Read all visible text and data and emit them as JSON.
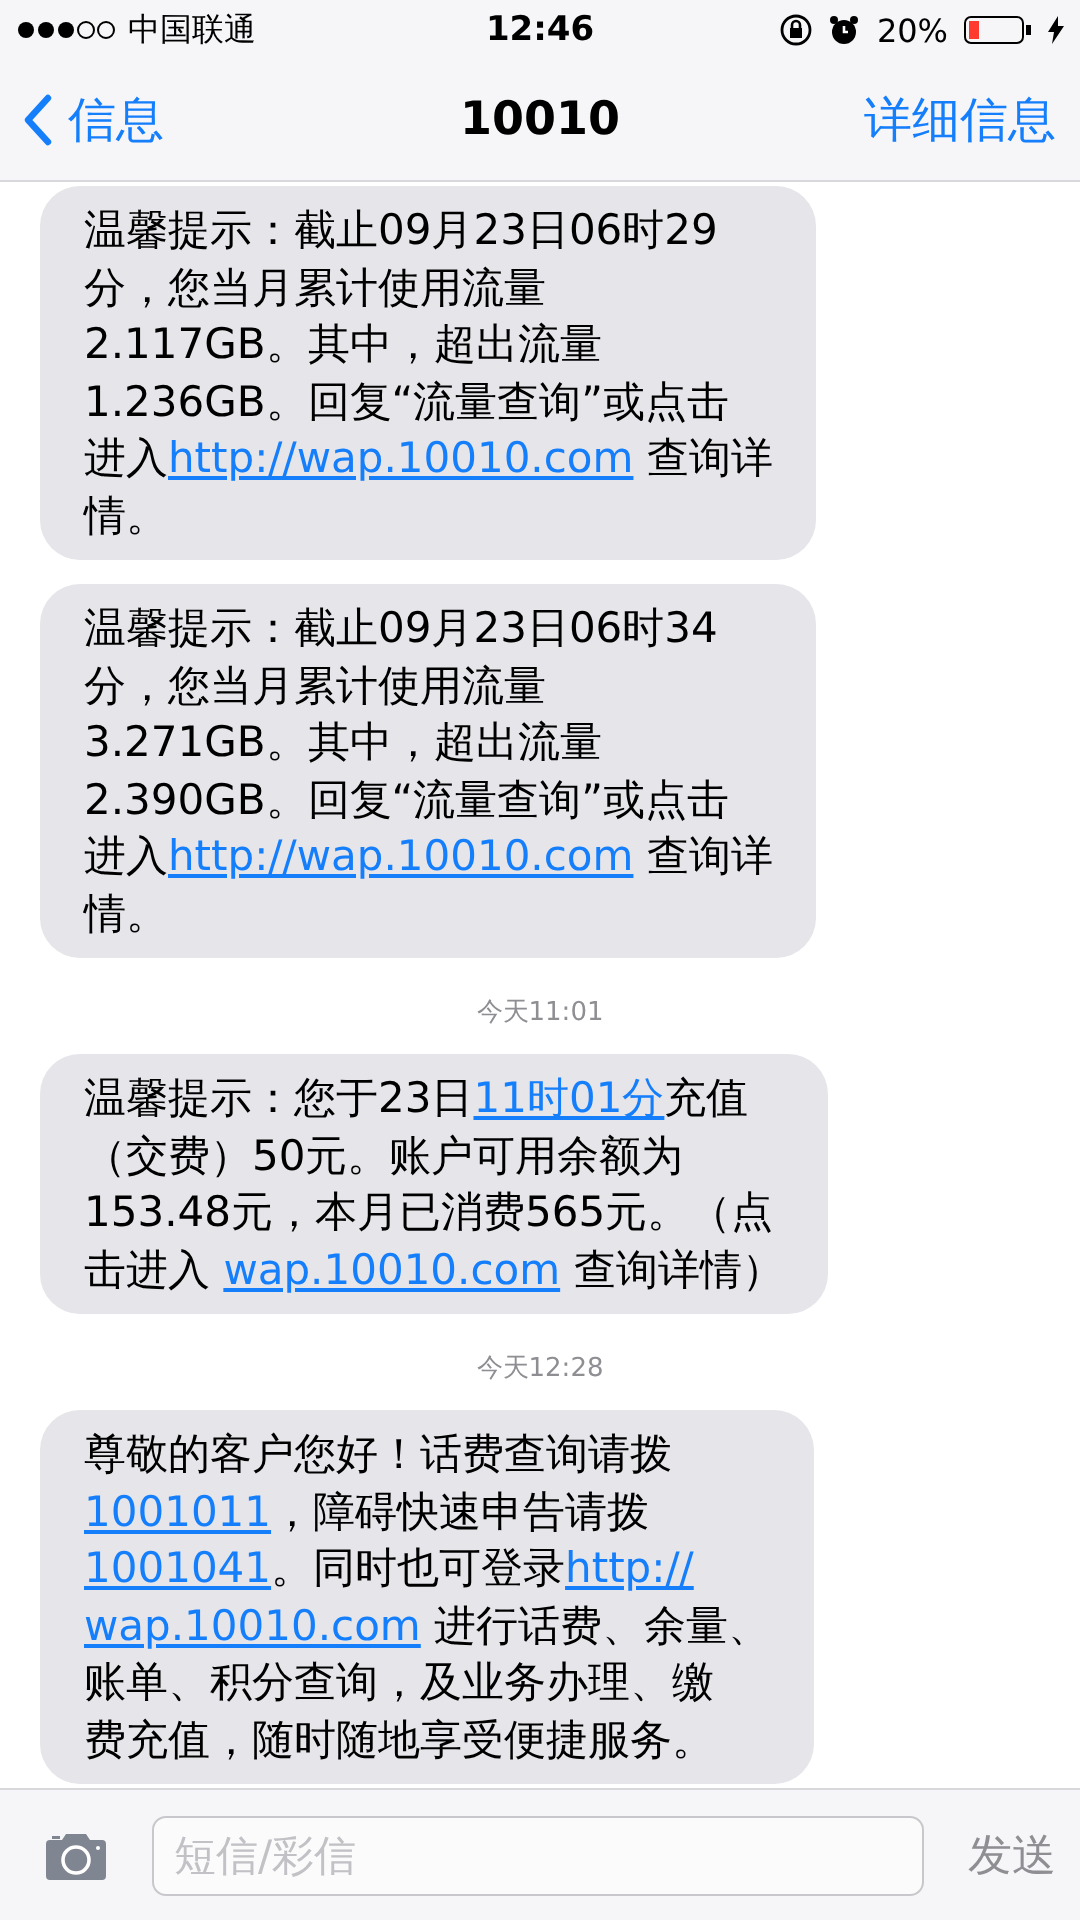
{
  "status_bar": {
    "carrier": "中国联通",
    "time": "12:46",
    "battery": "20%"
  },
  "nav": {
    "back": "信息",
    "title": "10010",
    "action": "详细信息"
  },
  "messages": [
    {
      "kind": "bubble",
      "lines": [
        [
          {
            "kind": "text",
            "text": "温馨提示：截止09月23日06时29"
          }
        ],
        [
          {
            "kind": "text",
            "text": "分，您当月累计使用流量"
          }
        ],
        [
          {
            "kind": "text",
            "text": "2.117GB。其中，超出流量"
          }
        ],
        [
          {
            "kind": "text",
            "text": "1.236GB。回复“流量查询”或点击"
          }
        ],
        [
          {
            "kind": "text",
            "text": "进入"
          },
          {
            "kind": "link",
            "text": "http://wap.10010.com"
          },
          {
            "kind": "text",
            "text": " 查询详"
          }
        ],
        [
          {
            "kind": "text",
            "text": "情。"
          }
        ]
      ]
    },
    {
      "kind": "bubble",
      "lines": [
        [
          {
            "kind": "text",
            "text": "温馨提示：截止09月23日06时34"
          }
        ],
        [
          {
            "kind": "text",
            "text": "分，您当月累计使用流量"
          }
        ],
        [
          {
            "kind": "text",
            "text": "3.271GB。其中，超出流量"
          }
        ],
        [
          {
            "kind": "text",
            "text": "2.390GB。回复“流量查询”或点击"
          }
        ],
        [
          {
            "kind": "text",
            "text": "进入"
          },
          {
            "kind": "link",
            "text": "http://wap.10010.com"
          },
          {
            "kind": "text",
            "text": " 查询详"
          }
        ],
        [
          {
            "kind": "text",
            "text": "情。"
          }
        ]
      ]
    },
    {
      "kind": "timestamp",
      "text": "今天11:01"
    },
    {
      "kind": "bubble",
      "lines": [
        [
          {
            "kind": "text",
            "text": "温馨提示：您于23日"
          },
          {
            "kind": "link",
            "text": "11时01分"
          },
          {
            "kind": "text",
            "text": "充值"
          }
        ],
        [
          {
            "kind": "text",
            "text": "（交费）50元。账户可用余额为"
          }
        ],
        [
          {
            "kind": "text",
            "text": "153.48元，本月已消费565元。（点"
          }
        ],
        [
          {
            "kind": "text",
            "text": "击进入 "
          },
          {
            "kind": "link",
            "text": "wap.10010.com"
          },
          {
            "kind": "text",
            "text": " 查询详情）"
          }
        ]
      ]
    },
    {
      "kind": "timestamp",
      "text": "今天12:28"
    },
    {
      "kind": "bubble",
      "lines": [
        [
          {
            "kind": "text",
            "text": "尊敬的客户您好！话费查询请拨"
          }
        ],
        [
          {
            "kind": "link",
            "text": "1001011"
          },
          {
            "kind": "text",
            "text": "，障碍快速申告请拨"
          }
        ],
        [
          {
            "kind": "link",
            "text": "1001041"
          },
          {
            "kind": "text",
            "text": "。同时也可登录"
          },
          {
            "kind": "link",
            "text": "http://"
          }
        ],
        [
          {
            "kind": "link",
            "text": "wap.10010.com"
          },
          {
            "kind": "text",
            "text": " 进行话费、余量、"
          }
        ],
        [
          {
            "kind": "text",
            "text": "账单、积分查询，及业务办理、缴"
          }
        ],
        [
          {
            "kind": "text",
            "text": "费充值，随时随地享受便捷服务。"
          }
        ]
      ]
    }
  ],
  "composer": {
    "placeholder": "短信/彩信",
    "send": "发送",
    "send_disabled": true
  }
}
